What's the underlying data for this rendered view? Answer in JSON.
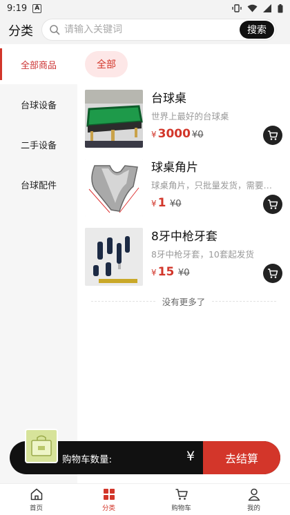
{
  "status_bar": {
    "time": "9:19",
    "app_badge": "A"
  },
  "header": {
    "title": "分类",
    "search_placeholder": "请输入关键词",
    "search_button": "搜索"
  },
  "sidebar": {
    "items": [
      {
        "label": "全部商品",
        "active": true
      },
      {
        "label": "台球设备"
      },
      {
        "label": "二手设备"
      },
      {
        "label": "台球配件"
      }
    ]
  },
  "filter_chip": "全部",
  "products": [
    {
      "name": "台球桌",
      "desc": "世界上最好的台球桌",
      "currency": "¥",
      "price": "3000",
      "orig_price": "¥0"
    },
    {
      "name": "球桌角片",
      "desc": "球桌角片，只批量发货，需要…",
      "currency": "¥",
      "price": "1",
      "orig_price": "¥0"
    },
    {
      "name": "8牙中枪牙套",
      "desc": "8牙中枪牙套，10套起发货",
      "currency": "¥",
      "price": "15",
      "orig_price": "¥0"
    }
  ],
  "no_more": "没有更多了",
  "cart_bar": {
    "count_label": "购物车数量:",
    "total": "¥",
    "checkout": "去结算"
  },
  "tabbar": [
    {
      "label": "首页",
      "icon": "home-icon"
    },
    {
      "label": "分类",
      "icon": "category-icon",
      "active": true
    },
    {
      "label": "购物车",
      "icon": "cart-icon"
    },
    {
      "label": "我的",
      "icon": "user-icon"
    }
  ],
  "colors": {
    "accent": "#d2362a",
    "chip_bg": "#fde7e7",
    "sidebar_bg": "#f6f6f6",
    "dark": "#111111"
  }
}
